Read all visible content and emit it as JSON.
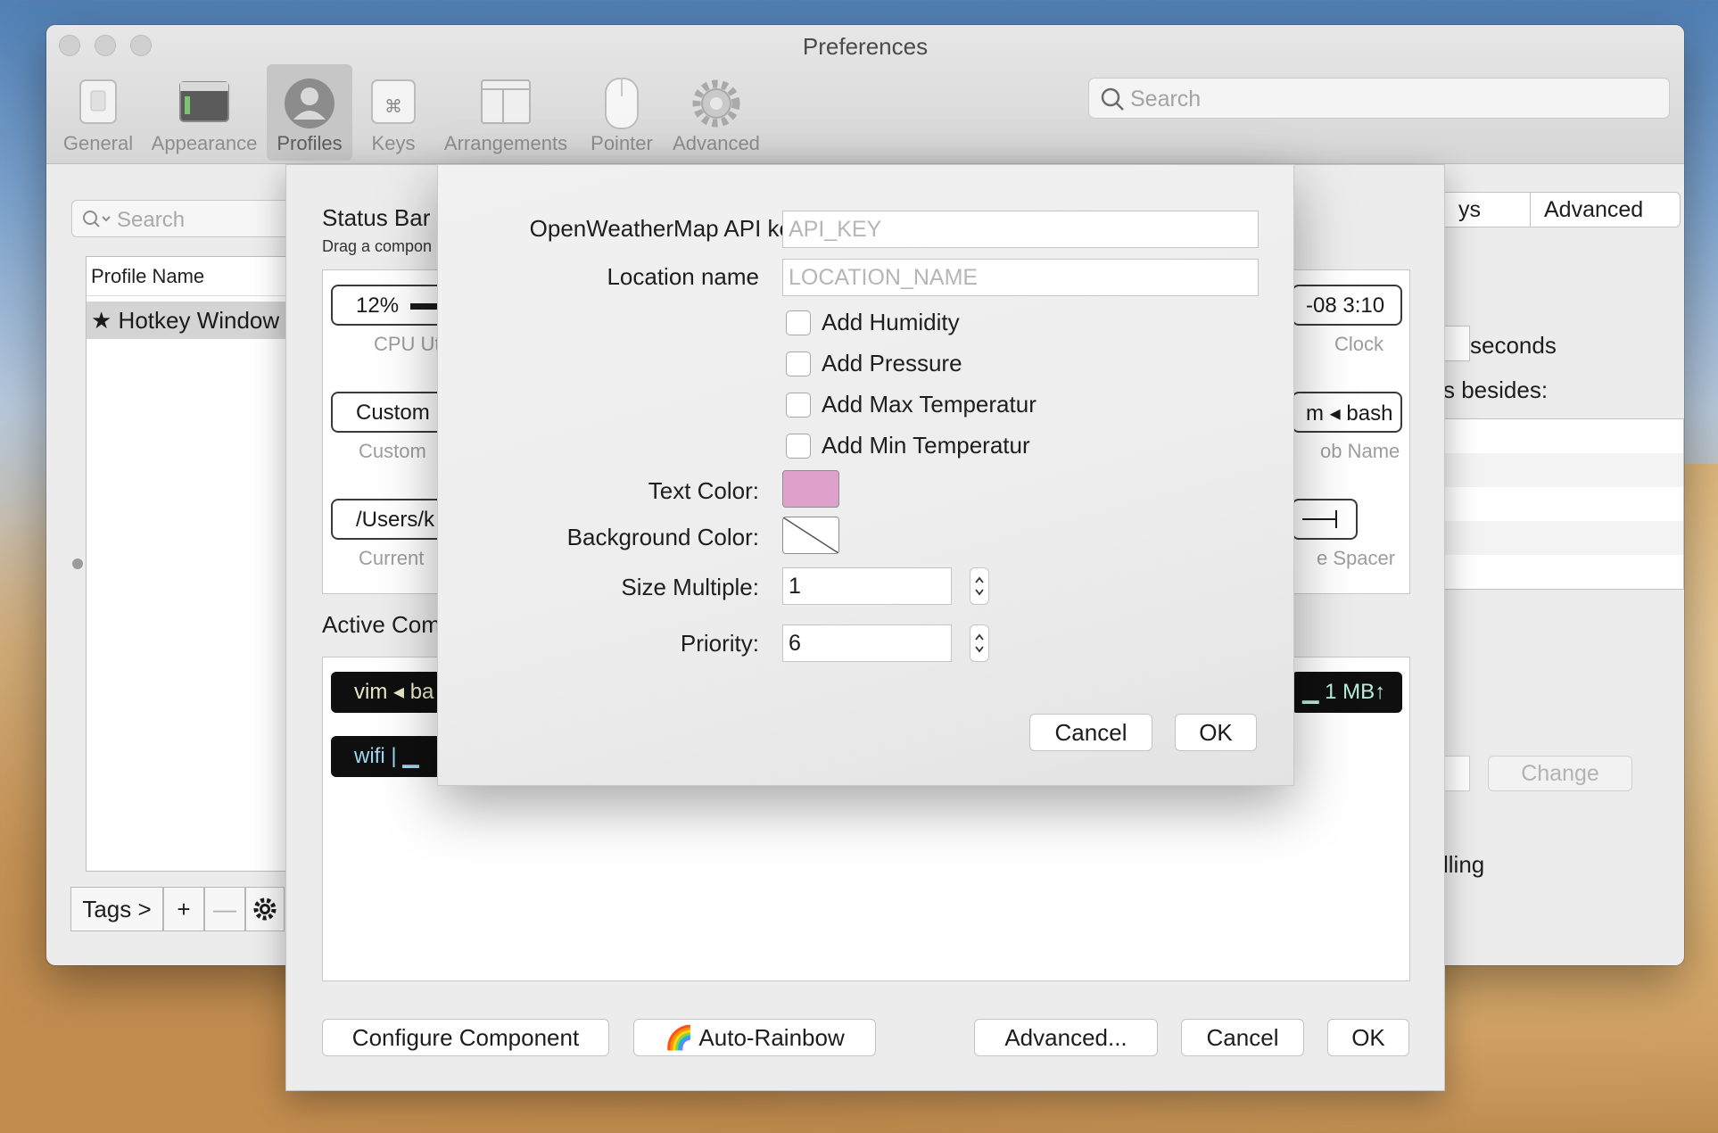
{
  "window": {
    "title": "Preferences",
    "search_placeholder": "Search",
    "toolbar": [
      {
        "label": "General",
        "icon": "switch-icon"
      },
      {
        "label": "Appearance",
        "icon": "window-icon"
      },
      {
        "label": "Profiles",
        "icon": "person-icon"
      },
      {
        "label": "Keys",
        "icon": "command-key-icon"
      },
      {
        "label": "Arrangements",
        "icon": "windows-icon"
      },
      {
        "label": "Pointer",
        "icon": "mouse-icon"
      },
      {
        "label": "Advanced",
        "icon": "gear-icon"
      }
    ],
    "active_tab": "Profiles"
  },
  "profiles": {
    "search_placeholder": "Search",
    "column_header": "Profile Name",
    "rows": [
      {
        "name": "Hotkey Window",
        "starred": true
      }
    ],
    "buttons": {
      "tags": "Tags >",
      "add": "+",
      "remove": "—"
    }
  },
  "right_panel": {
    "tab_partial": "ys",
    "tab_advanced": "Advanced",
    "seconds": "seconds",
    "besides": "s besides:",
    "change": "Change",
    "scrolling": "lling"
  },
  "status_sheet": {
    "title": "Status Bar",
    "subtitle": "Drag a compon",
    "components": {
      "cpu_value": "12%",
      "cpu_label": "CPU Ut",
      "custom_value": "Custom",
      "custom_label": "Custom",
      "dir_value": "/Users/k",
      "dir_label": "Current",
      "clock_value": "-08 3:10",
      "clock_label": "Clock",
      "job_value": "m ◂ bash",
      "job_label": "ob Name",
      "spacer_label": "e Spacer"
    },
    "active_title": "Active Com",
    "active": {
      "pill1": "vim ◂ ba",
      "pill2": "wifi  |  ▁",
      "pill3": "▁ 1 MB↑"
    },
    "buttons": {
      "configure": "Configure Component",
      "rainbow": "🌈 Auto-Rainbow",
      "advanced": "Advanced...",
      "cancel": "Cancel",
      "ok": "OK"
    }
  },
  "modal": {
    "api_key_label": "OpenWeatherMap API key",
    "api_key_placeholder": "API_KEY",
    "location_label": "Location name",
    "location_placeholder": "LOCATION_NAME",
    "checkboxes": [
      "Add Humidity",
      "Add Pressure",
      "Add Max Temperatur",
      "Add Min Temperatur"
    ],
    "text_color_label": "Text Color:",
    "text_color": "#dda1cc",
    "bg_color_label": "Background Color:",
    "size_label": "Size Multiple:",
    "size_value": "1",
    "priority_label": "Priority:",
    "priority_value": "6",
    "cancel": "Cancel",
    "ok": "OK"
  }
}
